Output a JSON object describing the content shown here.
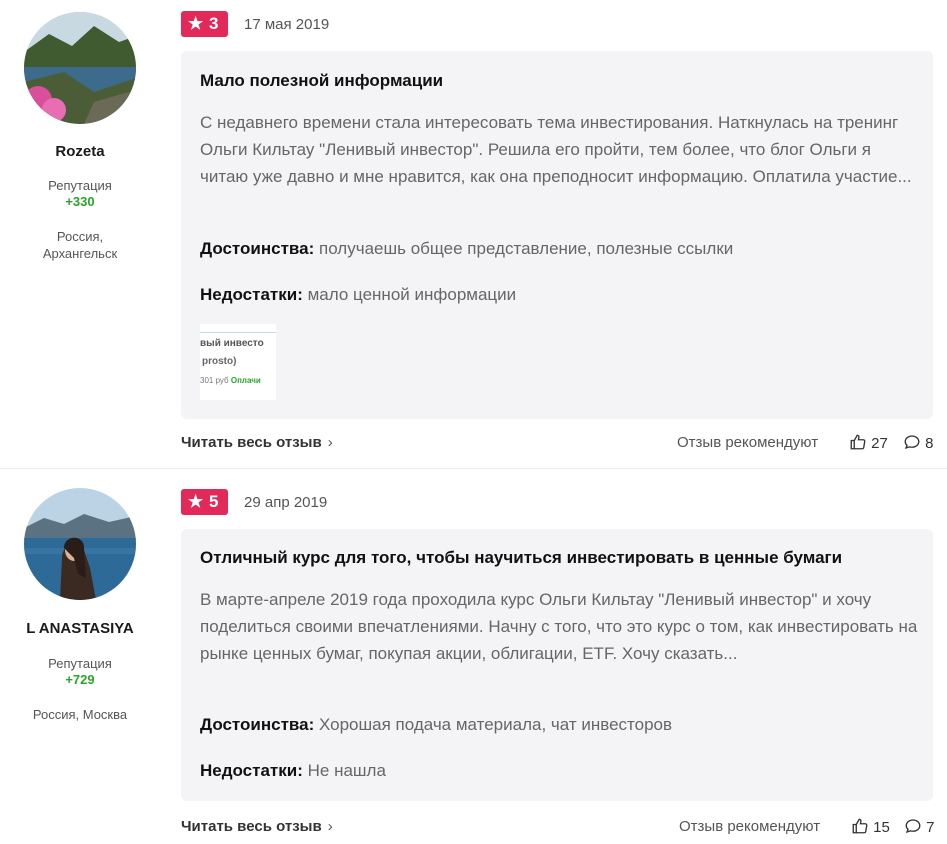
{
  "reviews": [
    {
      "author": {
        "name": "Rozeta",
        "reputation_label": "Репутация",
        "reputation_value": "+330",
        "location": "Россия, Архангельск"
      },
      "rating": "3",
      "date": "17 мая 2019",
      "title": "Мало полезной информации",
      "text": "С недавнего времени стала интересовать тема инвестирования. Наткнулась на тренинг Ольги Кильтау \"Ленивый инвестор\". Решила его пройти, тем более, что блог Ольги я читаю уже давно и мне нравится, как она преподносит информацию. Оплатила участие...",
      "pros_label": "Достоинства:",
      "pros": "получаешь общее представление, полезные ссылки",
      "cons_label": "Недостатки:",
      "cons": "мало ценной информации",
      "thumbnail": {
        "line1": "вый инвесто",
        "line2": "prosto)",
        "line3a": "301 руб",
        "line3b": "Оплачи"
      },
      "read_more": "Читать весь отзыв",
      "recommend_label": "Отзыв рекомендуют",
      "likes": "27",
      "comments": "8"
    },
    {
      "author": {
        "name": "L ANASTASIYA",
        "reputation_label": "Репутация",
        "reputation_value": "+729",
        "location": "Россия, Москва"
      },
      "rating": "5",
      "date": "29 апр 2019",
      "title": "Отличный курс для того, чтобы научиться инвестировать в ценные бумаги",
      "text": "В марте-апреле 2019 года проходила курс Ольги Кильтау \"Ленивый инвестор\" и хочу поделиться своими впечатлениями. Начну с того, что это курс о том, как инвестировать на рынке ценных бумаг, покупая акции, облигации, ETF. Хочу сказать...",
      "pros_label": "Достоинства:",
      "pros": "Хорошая подача материала, чат инвесторов",
      "cons_label": "Недостатки:",
      "cons": "Не нашла",
      "read_more": "Читать весь отзыв",
      "recommend_label": "Отзыв рекомендуют",
      "likes": "15",
      "comments": "7"
    }
  ],
  "colors": {
    "badge": "#e1295a",
    "reputation": "#2aa52a",
    "card_bg": "#f4f4f6"
  },
  "icons": [
    "star-icon",
    "chevron-right-icon",
    "thumbs-up-icon",
    "comment-icon"
  ]
}
